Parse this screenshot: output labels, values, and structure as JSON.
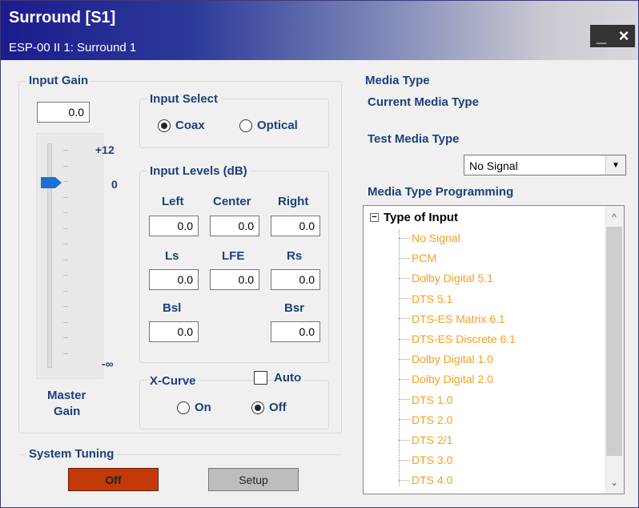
{
  "window": {
    "title": "Surround  [S1]",
    "subtitle": "ESP-00 II 1: Surround 1",
    "minimize_label": "_",
    "close_label": "×"
  },
  "input_gain": {
    "title": "Input Gain",
    "value": "0.0",
    "scale_top": "+12",
    "scale_zero": "0",
    "scale_bottom": "-∞",
    "caption_line1": "Master",
    "caption_line2": "Gain",
    "slider_level_db": 0
  },
  "input_select": {
    "title": "Input Select",
    "options": [
      {
        "label": "Coax",
        "selected": true
      },
      {
        "label": "Optical",
        "selected": false
      }
    ]
  },
  "input_levels": {
    "title": "Input Levels (dB)",
    "left": {
      "label": "Left",
      "value": "0.0"
    },
    "center": {
      "label": "Center",
      "value": "0.0"
    },
    "right": {
      "label": "Right",
      "value": "0.0"
    },
    "ls": {
      "label": "Ls",
      "value": "0.0"
    },
    "lfe": {
      "label": "LFE",
      "value": "0.0"
    },
    "rs": {
      "label": "Rs",
      "value": "0.0"
    },
    "bsl": {
      "label": "Bsl",
      "value": "0.0"
    },
    "bsr": {
      "label": "Bsr",
      "value": "0.0"
    }
  },
  "x_curve": {
    "title": "X-Curve",
    "auto_label": "Auto",
    "auto_checked": false,
    "on_label": "On",
    "off_label": "Off",
    "selected": "Off"
  },
  "system_tuning": {
    "title": "System Tuning",
    "off_button": "Off",
    "setup_button": "Setup",
    "accent_color": "#c23a0a"
  },
  "media_type": {
    "title": "Media Type",
    "current_label": "Current Media Type",
    "test_label": "Test Media Type",
    "test_selected": "No Signal",
    "programming_label": "Media Type Programming",
    "tree_root": "Type of Input",
    "tree_items": [
      "No Signal",
      "PCM",
      "Dolby Digital 5.1",
      "DTS 5.1",
      "DTS-ES Matrix 6.1",
      "DTS-ES Discrete 6.1",
      "Dolby Digital 1.0",
      "Dolby Digital 2.0",
      "DTS 1.0",
      "DTS 2.0",
      "DTS 2/1",
      "DTS 3.0",
      "DTS 4.0"
    ],
    "item_color": "#f5a020"
  }
}
